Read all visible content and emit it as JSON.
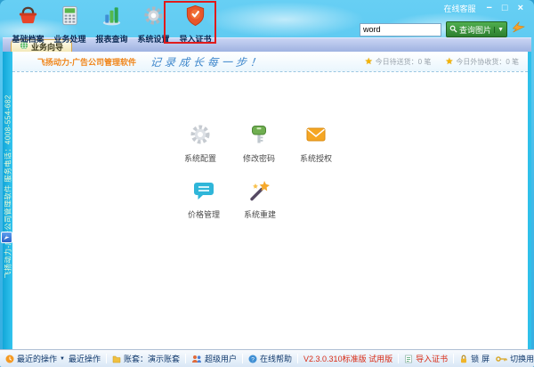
{
  "window": {
    "online_service": "在线客服",
    "controls": {
      "minimize": "−",
      "maximize": "□",
      "close": "×"
    }
  },
  "toolbar": {
    "items": [
      {
        "label": "基础档案",
        "icon": "basket-icon"
      },
      {
        "label": "业务处理",
        "icon": "calculator-icon"
      },
      {
        "label": "报表查询",
        "icon": "bar-chart-icon"
      },
      {
        "label": "系统设置",
        "icon": "gear-icon"
      },
      {
        "label": "导入证书",
        "icon": "shield-check-icon",
        "highlighted": true
      }
    ],
    "search": {
      "value": "word",
      "button_label": "查询图片",
      "pointer_icon": "paper-plane-icon"
    }
  },
  "tabbar": {
    "tabs": [
      {
        "label": "业务向导",
        "icon": "globe-icon"
      }
    ]
  },
  "side_banner": {
    "text": "飞扬动力-广告公司管理软件  服务电话：4008-554-682"
  },
  "content_header": {
    "brand": "飞扬动力-广告公司管理软件",
    "slogan": "记录成长每一步！",
    "stats": [
      {
        "text": "今日待送货：0 笔",
        "icon": "star-icon"
      },
      {
        "text": "今日外协收货：0 笔",
        "icon": "star-icon"
      }
    ]
  },
  "shortcuts": [
    {
      "label": "系统配置",
      "icon": "gear-icon"
    },
    {
      "label": "修改密码",
      "icon": "key-icon"
    },
    {
      "label": "系统授权",
      "icon": "envelope-icon"
    },
    {
      "label": "价格管理",
      "icon": "chat-bubble-icon"
    },
    {
      "label": "系统重建",
      "icon": "magic-wand-icon"
    }
  ],
  "statusbar": {
    "recent_dropdown": "最近的操作",
    "recent": "最近操作",
    "account": "账套：演示账套",
    "user": "超级用户",
    "help": "在线帮助",
    "version": "V2.3.0.310标准版 试用版",
    "import_cert": "导入证书",
    "lock": "锁屏",
    "switch_user": "切换用户"
  },
  "colors": {
    "chrome_blue": "#40b8e8",
    "strip_cyan": "#1cb5e2",
    "tab_fill": "#f5e9b8",
    "button_green": "#3c9e3c",
    "highlight_red": "#e11b1b",
    "brand_orange": "#f08519",
    "slogan_blue": "#3e87cc",
    "version_red": "#d92c17"
  }
}
